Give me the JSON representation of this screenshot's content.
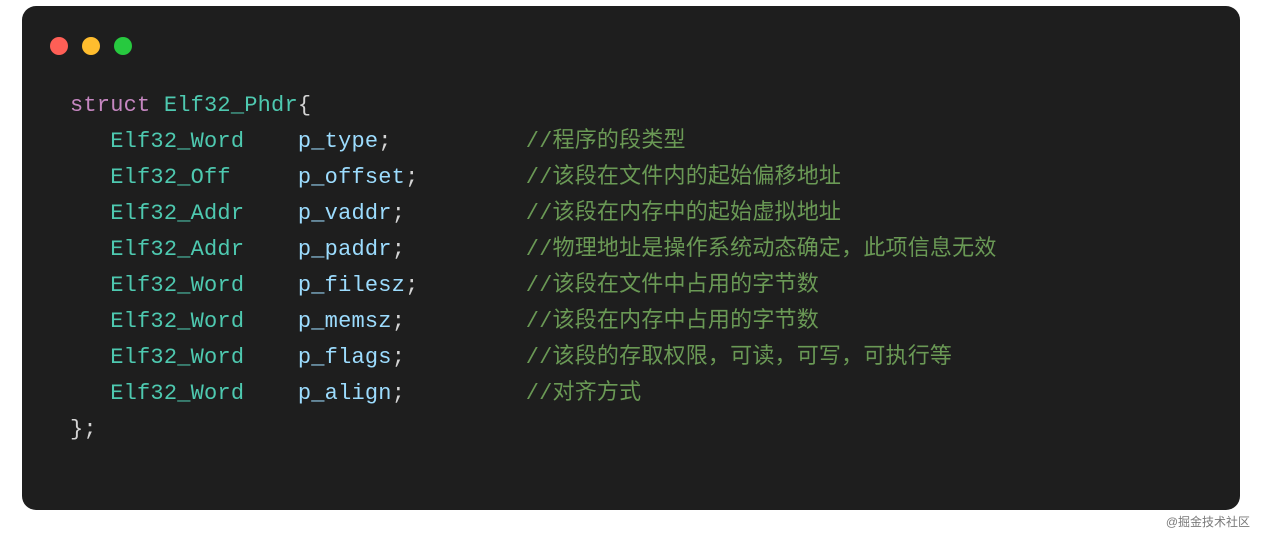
{
  "watermark": "@掘金技术社区",
  "struct_keyword": "struct",
  "struct_name": "Elf32_Phdr",
  "open_brace": "{",
  "close_brace": "};",
  "fields": [
    {
      "type": "Elf32_Word",
      "name": "p_type",
      "comment": "//程序的段类型"
    },
    {
      "type": "Elf32_Off",
      "name": "p_offset",
      "comment": "//该段在文件内的起始偏移地址"
    },
    {
      "type": "Elf32_Addr",
      "name": "p_vaddr",
      "comment": "//该段在内存中的起始虚拟地址"
    },
    {
      "type": "Elf32_Addr",
      "name": "p_paddr",
      "comment": "//物理地址是操作系统动态确定，此项信息无效"
    },
    {
      "type": "Elf32_Word",
      "name": "p_filesz",
      "comment": "//该段在文件中占用的字节数"
    },
    {
      "type": "Elf32_Word",
      "name": "p_memsz",
      "comment": "//该段在内存中占用的字节数"
    },
    {
      "type": "Elf32_Word",
      "name": "p_flags",
      "comment": "//该段的存取权限，可读，可写，可执行等"
    },
    {
      "type": "Elf32_Word",
      "name": "p_align",
      "comment": "//对齐方式"
    }
  ]
}
